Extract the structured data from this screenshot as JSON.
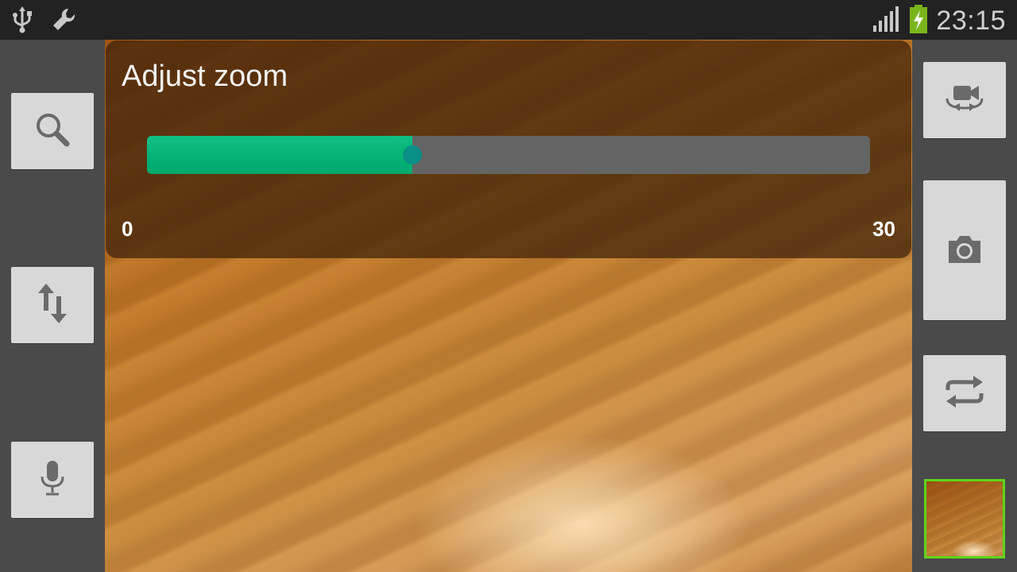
{
  "status_bar": {
    "time": "23:15",
    "icons": [
      "usb-icon",
      "wrench-icon",
      "signal-icon",
      "battery-charging-icon"
    ]
  },
  "left_toolbar": {
    "buttons": [
      {
        "icon": "magnifier-icon"
      },
      {
        "icon": "swap-vertical-icon"
      },
      {
        "icon": "microphone-icon"
      }
    ]
  },
  "right_toolbar": {
    "buttons": [
      {
        "icon": "switch-camera-video-icon"
      },
      {
        "icon": "camera-icon"
      },
      {
        "icon": "repeat-icon"
      }
    ]
  },
  "zoom_dialog": {
    "title": "Adjust zoom",
    "min_label": "0",
    "max_label": "30",
    "value": 11,
    "min": 0,
    "max": 30
  },
  "colors": {
    "slider_fill": "#10c084",
    "slider_track": "#646464",
    "thumbnail_border": "#5fd31a",
    "battery": "#7ab51d"
  }
}
